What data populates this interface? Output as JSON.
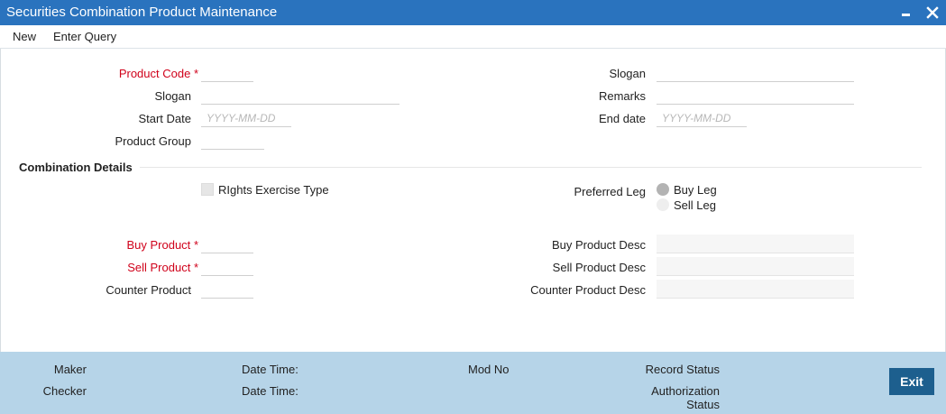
{
  "window": {
    "title": "Securities Combination Product Maintenance",
    "minimize_icon": "minimize-icon",
    "close_icon": "close-icon"
  },
  "menu": {
    "new": "New",
    "enter_query": "Enter Query"
  },
  "form": {
    "product_code_label": "Product Code",
    "required_mark": "*",
    "slogan_left_label": "Slogan",
    "start_date_label": "Start Date",
    "date_placeholder": "YYYY-MM-DD",
    "product_group_label": "Product Group",
    "slogan_right_label": "Slogan",
    "remarks_label": "Remarks",
    "end_date_label": "End date"
  },
  "combination": {
    "section_title": "Combination Details",
    "rights_exercise_label": "RIghts Exercise Type",
    "preferred_leg_label": "Preferred Leg",
    "buy_leg_label": "Buy Leg",
    "sell_leg_label": "Sell Leg",
    "selected_leg": "Buy Leg",
    "buy_product_label": "Buy Product",
    "sell_product_label": "Sell Product",
    "counter_product_label": "Counter Product",
    "buy_product_desc_label": "Buy Product Desc",
    "sell_product_desc_label": "Sell Product Desc",
    "counter_product_desc_label": "Counter Product Desc"
  },
  "footer": {
    "maker": "Maker",
    "checker": "Checker",
    "date_time_1": "Date Time:",
    "date_time_2": "Date Time:",
    "mod_no": "Mod No",
    "record_status": "Record Status",
    "authorization": "Authorization",
    "status": "Status",
    "exit": "Exit"
  },
  "colors": {
    "titlebar": "#2a73be",
    "required": "#d0021b",
    "footer": "#b6d4e8",
    "exit_button": "#1d5f8e"
  }
}
